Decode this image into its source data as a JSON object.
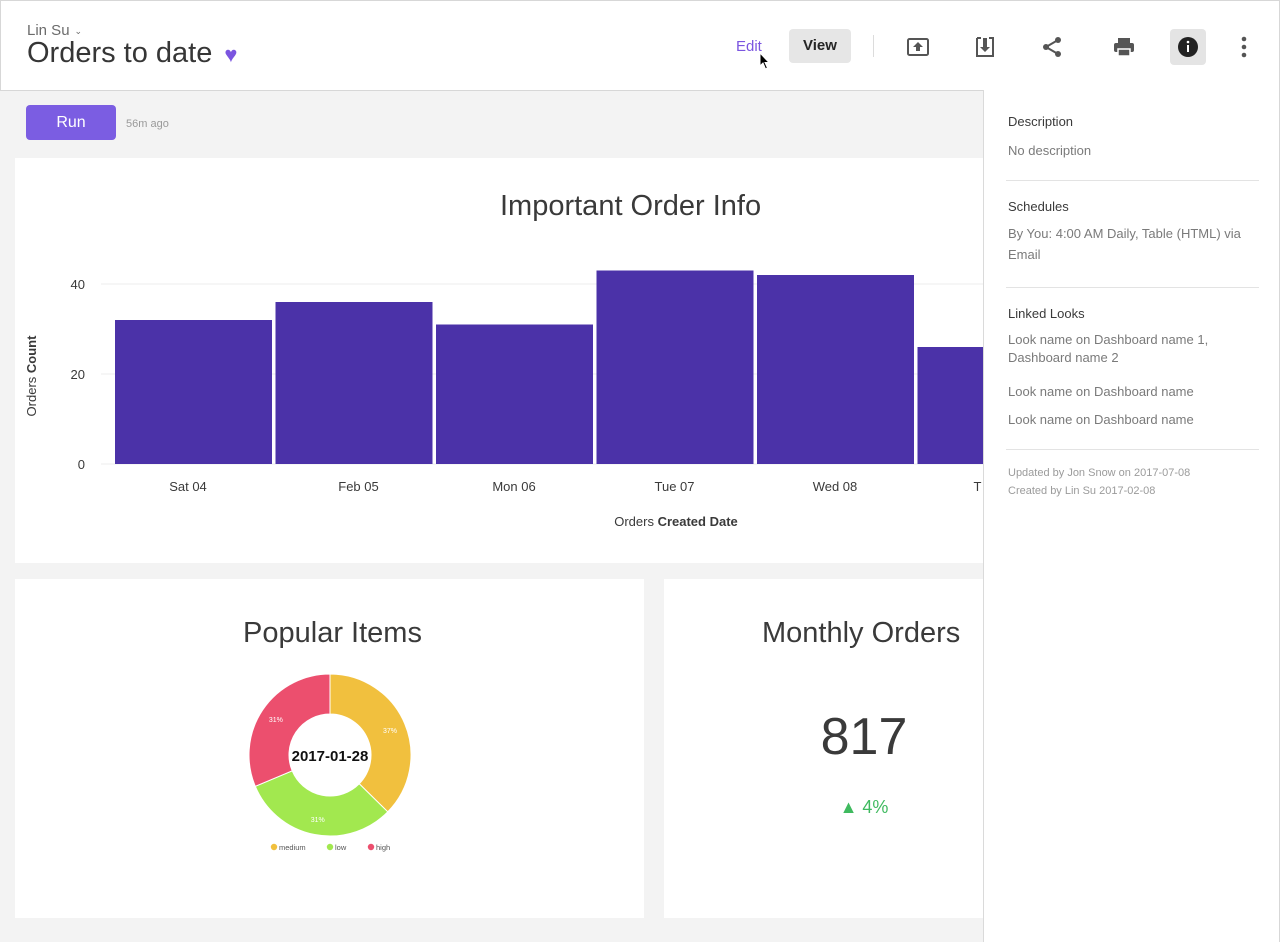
{
  "header": {
    "owner": "Lin Su",
    "title": "Orders to date",
    "edit_label": "Edit",
    "view_label": "View",
    "accent_color": "#7b55e0",
    "tools": [
      "upload-icon",
      "download-icon",
      "share-icon",
      "print-icon",
      "info-icon",
      "more-vertical-icon"
    ]
  },
  "runbar": {
    "run_label": "Run",
    "last_run": "56m ago"
  },
  "bar_card": {
    "title": "Important Order Info"
  },
  "pie_card": {
    "title": "Popular Items"
  },
  "kpi_card": {
    "title": "Monthly Orders",
    "value": "817",
    "change": "4%",
    "change_direction": "up",
    "change_color": "#3fba5f"
  },
  "info_panel": {
    "description_heading": "Description",
    "description_text": "No description",
    "schedules_heading": "Schedules",
    "schedules_text": "By You: 4:00 AM Daily, Table (HTML) via Email",
    "linked_heading": "Linked Looks",
    "linked_items": [
      "Look name on Dashboard name 1, Dashboard name 2",
      "Look name on Dashboard name",
      "Look name on Dashboard name"
    ],
    "updated": "Updated by Jon Snow on 2017-07-08",
    "created": "Created by Lin Su 2017-02-08"
  },
  "chart_data": [
    {
      "type": "bar",
      "title": "Important Order Info",
      "categories": [
        "Sat 04",
        "Feb 05",
        "Mon 06",
        "Tue 07",
        "Wed 08",
        "T"
      ],
      "values": [
        32,
        36,
        31,
        43,
        42,
        26
      ],
      "xlabel": "Orders Created Date",
      "xlabel_plain": "Orders",
      "xlabel_bold": "Created Date",
      "ylabel": "Orders Count",
      "ylabel_plain": "Orders",
      "ylabel_bold": "Count",
      "ylim": [
        0,
        40
      ],
      "yticks": [
        0,
        20,
        40
      ],
      "bar_color": "#4b32a8",
      "grid": true
    },
    {
      "type": "pie",
      "title": "Popular Items",
      "center_label": "2017-01-28",
      "slices": [
        {
          "name": "medium",
          "value": 37,
          "label": "37%",
          "color": "#f1c03e"
        },
        {
          "name": "low",
          "value": 31,
          "label": "31%",
          "color": "#a2e84f"
        },
        {
          "name": "high",
          "value": 31,
          "label": "31%",
          "color": "#ec4f6e"
        }
      ]
    }
  ]
}
